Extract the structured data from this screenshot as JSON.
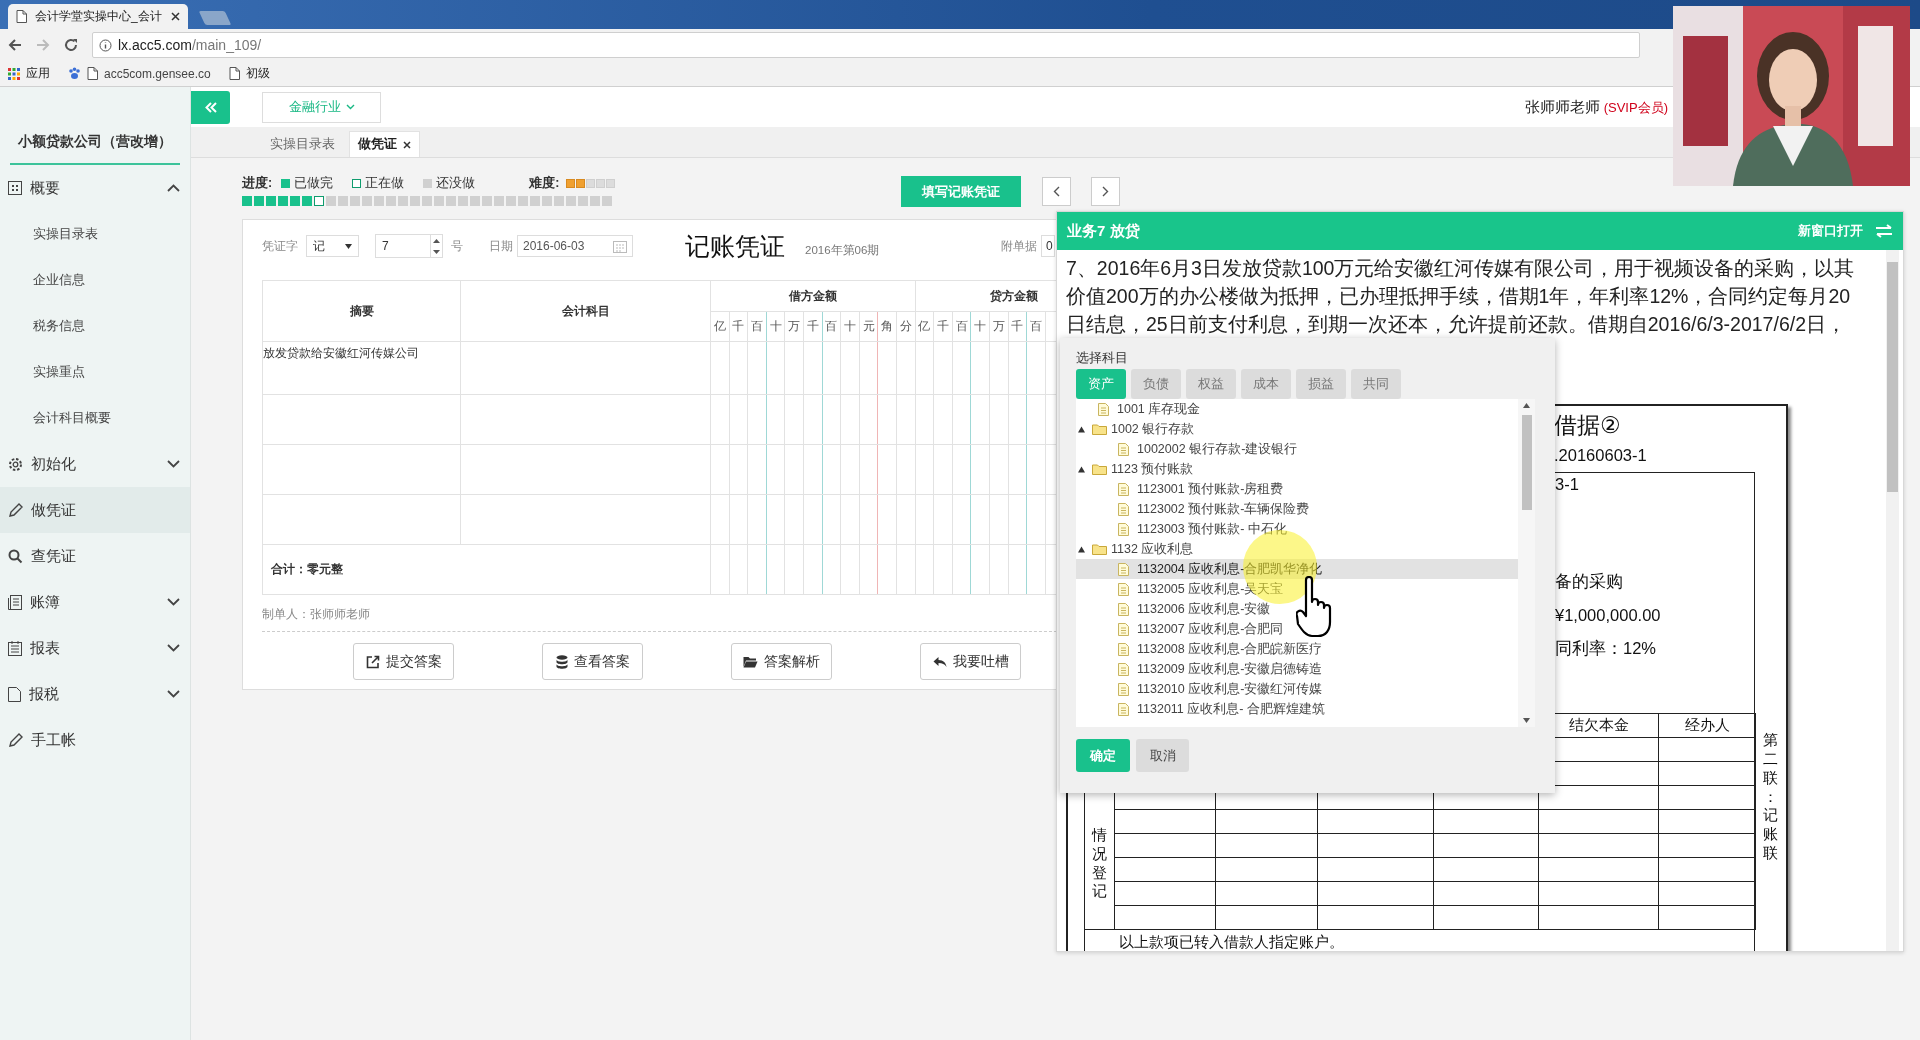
{
  "browser": {
    "tab_title": "会计学堂实操中心_会计",
    "url_host": "lx.acc5.com",
    "url_path": "/main_109/",
    "bookmarks": [
      "应用",
      "acc5com.gensee.co",
      "初级"
    ]
  },
  "sidebar": {
    "company": "小额贷款公司（营改增）",
    "items": [
      {
        "label": "概要",
        "expanded": true,
        "selected": false,
        "children": [
          {
            "label": "实操目录表",
            "selected": false
          },
          {
            "label": "企业信息",
            "selected": false
          },
          {
            "label": "税务信息",
            "selected": false
          },
          {
            "label": "实操重点",
            "selected": false
          },
          {
            "label": "会计科目概要",
            "selected": false
          }
        ]
      },
      {
        "label": "初始化",
        "expanded": false,
        "selected": false
      },
      {
        "label": "做凭证",
        "selected": true
      },
      {
        "label": "查凭证",
        "selected": false
      },
      {
        "label": "账簿",
        "expanded": false,
        "selected": false
      },
      {
        "label": "报表",
        "expanded": false,
        "selected": false
      },
      {
        "label": "报税",
        "expanded": false,
        "selected": false
      },
      {
        "label": "手工帐",
        "selected": false
      }
    ]
  },
  "header": {
    "industry": "金融行业",
    "user_name": "张师师老师",
    "user_level": "(SVIP会员)"
  },
  "tabs": [
    {
      "label": "实操目录表",
      "selected": false
    },
    {
      "label": "做凭证",
      "selected": true,
      "closable": true
    }
  ],
  "progress": {
    "label": "进度:",
    "legend": [
      {
        "label": "已做完",
        "kind": "done"
      },
      {
        "label": "正在做",
        "kind": "current"
      },
      {
        "label": "还没做",
        "kind": "todo"
      }
    ],
    "difficulty_label": "难度:",
    "stars": 2,
    "steps": [
      {
        "done": true,
        "current": false
      },
      {
        "done": true,
        "current": false
      },
      {
        "done": true,
        "current": false
      },
      {
        "done": true,
        "current": false
      },
      {
        "done": true,
        "current": false
      },
      {
        "done": true,
        "current": false
      },
      {
        "done": false,
        "current": true
      },
      {
        "done": false,
        "current": false
      },
      {
        "done": false,
        "current": false
      },
      {
        "done": false,
        "current": false
      },
      {
        "done": false,
        "current": false
      },
      {
        "done": false,
        "current": false
      },
      {
        "done": false,
        "current": false
      },
      {
        "done": false,
        "current": false
      },
      {
        "done": false,
        "current": false
      },
      {
        "done": false,
        "current": false
      },
      {
        "done": false,
        "current": false
      },
      {
        "done": false,
        "current": false
      },
      {
        "done": false,
        "current": false
      },
      {
        "done": false,
        "current": false
      },
      {
        "done": false,
        "current": false
      },
      {
        "done": false,
        "current": false
      },
      {
        "done": false,
        "current": false
      },
      {
        "done": false,
        "current": false
      },
      {
        "done": false,
        "current": false
      },
      {
        "done": false,
        "current": false
      },
      {
        "done": false,
        "current": false
      },
      {
        "done": false,
        "current": false
      },
      {
        "done": false,
        "current": false
      },
      {
        "done": false,
        "current": false
      },
      {
        "done": false,
        "current": false
      }
    ]
  },
  "fill_button": "填写记账凭证",
  "voucher": {
    "type_label": "凭证字",
    "type_value": "记",
    "number": "7",
    "number_suffix": "号",
    "date_label": "日期",
    "date": "2016-06-03",
    "title": "记账凭证",
    "period": "2016年第06期",
    "attach_label": "附单据",
    "attach_value": "0",
    "columns": {
      "summary": "摘要",
      "account": "会计科目",
      "debit": "借方金额",
      "credit": "贷方金额",
      "debit_units": [
        "亿",
        "千",
        "百",
        "十",
        "万",
        "千",
        "百",
        "十",
        "元",
        "角",
        "分"
      ],
      "credit_units": [
        "亿",
        "千",
        "百",
        "十",
        "万",
        "千",
        "百"
      ]
    },
    "rows": [
      {
        "kind": "entry",
        "summary": "放发贷款给安徽红河传媒公司"
      },
      {
        "kind": "empty"
      },
      {
        "kind": "empty"
      },
      {
        "kind": "empty"
      }
    ],
    "total": "合计：零元整",
    "maker": "制单人：张师师老师",
    "buttons": [
      "提交答案",
      "查看答案",
      "答案解析",
      "我要吐槽"
    ]
  },
  "panel": {
    "title": "业务7 放贷",
    "open_new": "新窗口打开",
    "text": "7、2016年6月3日发放贷款100万元给安徽红河传媒有限公司，用于视频设备的采购，以其价值200万的办公楼做为抵押，已办理抵押手续，借期1年，年利率12%，合同约定每月20日结息，25日前支付利息，到期一次还本，允许提前还款。借期自2016/6/3-2017/6/2日，",
    "document": {
      "title": "借据②",
      "number": ".20160603-1",
      "lines": [
        "3-1",
        "备的采购",
        "¥1,000,000.00",
        "同利率：12%"
      ],
      "table_headers": [
        "结欠本金",
        "经办人"
      ],
      "side_label": "情况登记",
      "copy_label": "第二联：记账联",
      "footer": "以上款项已转入借款人指定账户。"
    }
  },
  "dialog": {
    "title": "选择科目",
    "tabs": [
      {
        "label": "资产",
        "selected": true
      },
      {
        "label": "负债",
        "selected": false
      },
      {
        "label": "权益",
        "selected": false
      },
      {
        "label": "成本",
        "selected": false
      },
      {
        "label": "损益",
        "selected": false
      },
      {
        "label": "共同",
        "selected": false
      }
    ],
    "tree": [
      {
        "label": "1001 库存现金",
        "selected": false
      },
      {
        "label": "1002 银行存款",
        "expanded": true,
        "selected": false,
        "children": [
          {
            "label": "1002002 银行存款-建设银行",
            "selected": false
          }
        ]
      },
      {
        "label": "1123 预付账款",
        "expanded": true,
        "selected": false,
        "children": [
          {
            "label": "1123001 预付账款-房租费",
            "selected": false
          },
          {
            "label": "1123002 预付账款-车辆保险费",
            "selected": false
          },
          {
            "label": "1123003 预付账款- 中石化",
            "selected": false
          }
        ]
      },
      {
        "label": "1132 应收利息",
        "expanded": true,
        "selected": false,
        "children": [
          {
            "label": "1132004 应收利息-合肥凯华净化",
            "selected": true
          },
          {
            "label": "1132005 应收利息-吴天宝",
            "selected": false
          },
          {
            "label": "1132006 应收利息-安徽",
            "selected": false
          },
          {
            "label": "1132007 应收利息-合肥同",
            "selected": false
          },
          {
            "label": "1132008 应收利息-合肥皖新医疗",
            "selected": false
          },
          {
            "label": "1132009 应收利息-安徽启德铸造",
            "selected": false
          },
          {
            "label": "1132010 应收利息-安徽红河传媒",
            "selected": false
          },
          {
            "label": "1132011 应收利息- 合肥辉煌建筑",
            "selected": false
          }
        ]
      }
    ],
    "buttons": [
      {
        "label": "确定",
        "kind": "primary"
      },
      {
        "label": "取消",
        "kind": "secondary"
      }
    ]
  }
}
